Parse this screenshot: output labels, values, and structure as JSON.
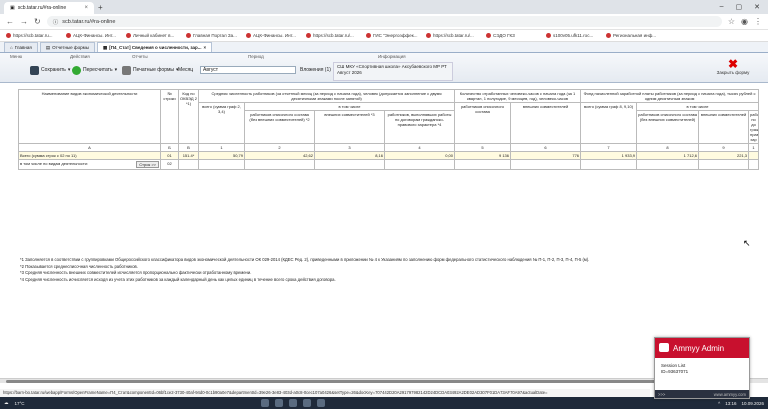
{
  "browser": {
    "tab_title": "scb.tatar.ru/#ra-online",
    "address": "scb.tatar.ru/#ra-online",
    "bookmarks": [
      "https://scb.tatar.ru...",
      "АЦК-Финансы. Инт...",
      "Личный кабинет в...",
      "Главная Портал За...",
      "АЦК-Финансы. Инт...",
      "https://scb.tatar.ru/...",
      "ГИС \"Энергоэффек...",
      "https://scb.tatar.ru/...",
      "СЭДО ГКЗ",
      "s100v05.ufk11.roc...",
      "Региональная инф..."
    ]
  },
  "app_tabs": [
    {
      "label": "Главная"
    },
    {
      "label": "Отчетные формы"
    },
    {
      "label": "[П4_Стат] Сведения о численности, зар..."
    }
  ],
  "ribbon": {
    "groups": {
      "menu": "Меню",
      "actions": "Действия",
      "reports": "Отчеты",
      "period": "Период",
      "info": "Информация"
    },
    "save": "Сохранить",
    "recalc": "Пересчитать",
    "print_forms": "Печатные формы",
    "period_label": "Месяц",
    "period_value": "Август",
    "attachments": "Вложения (1)",
    "info_org": "СШ МКУ «Спортивная школа» Аксубаевского МР РТ",
    "info_period": "Август 2026",
    "close_form": "Закрыть форму"
  },
  "table": {
    "headers": {
      "c0": "Наименование видов экономической деятельности",
      "c1": "№ строки",
      "c2": "Код по ОКВЭД 2 *1)",
      "g1": "Средняя численность работников (за отчетный месяц (за период с начала года), человек (допускается заполнение с двумя десятичными знаками после запятой)",
      "g2": "Количество отработанных человеко-часов с начала года (за 1 квартал, 1 полугодие, 9 месяцев, год), человеко-часов",
      "g3": "Фонд начисленной заработной платы работников (за период с начала года), тысяч рублей с одним десятичным знаком",
      "s1": "всего (сумма граф 2, 3,4)",
      "s_incl": "в том числе",
      "s2": "работников списочного состава (без внешних совместителей) *2",
      "s3": "внешних совместителей *3",
      "s4": "работников, выполнявших работы по договорам гражданско-правового характера *4",
      "s5": "работников списочного состава",
      "s6": "внешних совместителей",
      "s7": "всего (сумма граф 8, 9,10)",
      "s8": "работников списочного состава (без внешних совместителей)",
      "s9": "внешних совместителей",
      "s10": "рабо по до граж прав хар"
    },
    "num_row": [
      "А",
      "Б",
      "В",
      "1",
      "2",
      "3",
      "4",
      "5",
      "6",
      "7",
      "8",
      "9",
      "1"
    ],
    "total_row": {
      "label": "Всего (сумма строк с 02 по 11)",
      "line": "01",
      "okved": "151.4*",
      "v1": "50,79",
      "v2": "42,62",
      "v3": "8,16",
      "v4": "0,00",
      "v5": "9 136",
      "v6": "776",
      "v7": "1 933,9",
      "v8": "1 712,6",
      "v9": "221,3"
    },
    "sub_row": {
      "label": "в том числе по видам деятельности:",
      "button": "Строк >>",
      "line": "02"
    }
  },
  "footnotes": [
    "*1 Заполняется в соответствии с группировками Общероссийского классификатора видов экономической деятельности ОК 029-2014 (КДЕС Ред. 2), приведенными в приложении № 4 к Указаниям по заполнению форм федерального статистического наблюдения № П-1, П-2, П-3, П-4, П-5 (м).",
    "*2 Показывается среднесписочная численность работников.",
    "*3 Средняя численность внешних совместителей исчисляется пропорционально фактически отработанному времени.",
    "*4 Средняя численность исчисляется исходя из учета этих работников за каждый календарный день как целых единиц в течение всего срока действия договора."
  ],
  "status_url": "https://barn-bo.tatar.ru/webapp/Forms/OpenFrameName=П4_Стат&componentId=06bf1ce2-3730-40af-94d0-0c1b90a0e7&departmentId=39e26-3e83-403d-a0c8-0cec107a0426&setType=26&docKey=707442D20A291797982142D24DCDA03492A2DE02AD307F01DA73AF70A97&actualDate=",
  "taskbar": {
    "weather": "17°C",
    "time": "13:16",
    "date": "10.09.2026"
  },
  "ammyy": {
    "title": "Ammyy Admin",
    "session_label": "Session List",
    "session_id": "ID=93637071",
    "link": "www.ammyy.com",
    "more": ">>>"
  }
}
